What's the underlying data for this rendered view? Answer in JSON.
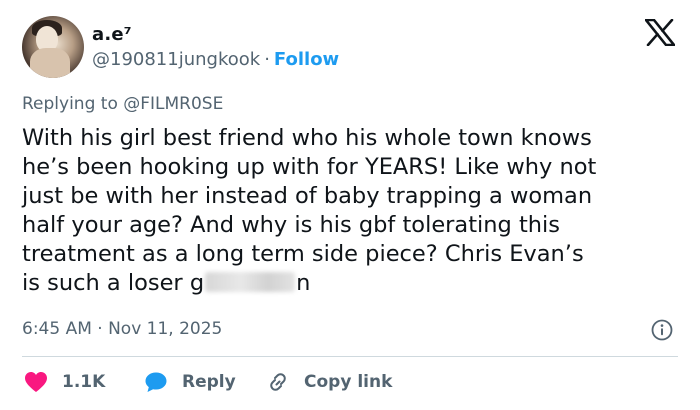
{
  "author": {
    "display_name": "a.e⁷",
    "handle": "@190811jungkook",
    "separator": "·",
    "follow_label": "Follow"
  },
  "reply_context": "Replying to @FILMR0SE",
  "tweet": {
    "lines": [
      "With his girl best friend who his whole town knows",
      "he’s been hooking up with for YEARS! Like why not",
      "just be with her instead of baby trapping a woman",
      "half your age? And why is his gbf tolerating this",
      "treatment as a long term side piece? Chris Evan’s"
    ],
    "last_line_before_blur": "is such a loser g",
    "last_line_after_blur": "n"
  },
  "timestamp": "6:45 AM · Nov 11, 2025",
  "actions": {
    "like_count": "1.1K",
    "reply_label": "Reply",
    "copy_label": "Copy link"
  },
  "colors": {
    "like": "#f91880",
    "reply": "#1d9bf0",
    "follow": "#1d9bf0",
    "muted": "#536471"
  },
  "icons": [
    "avatar",
    "x-logo-icon",
    "info-icon",
    "heart-icon",
    "reply-bubble-icon",
    "link-icon"
  ]
}
